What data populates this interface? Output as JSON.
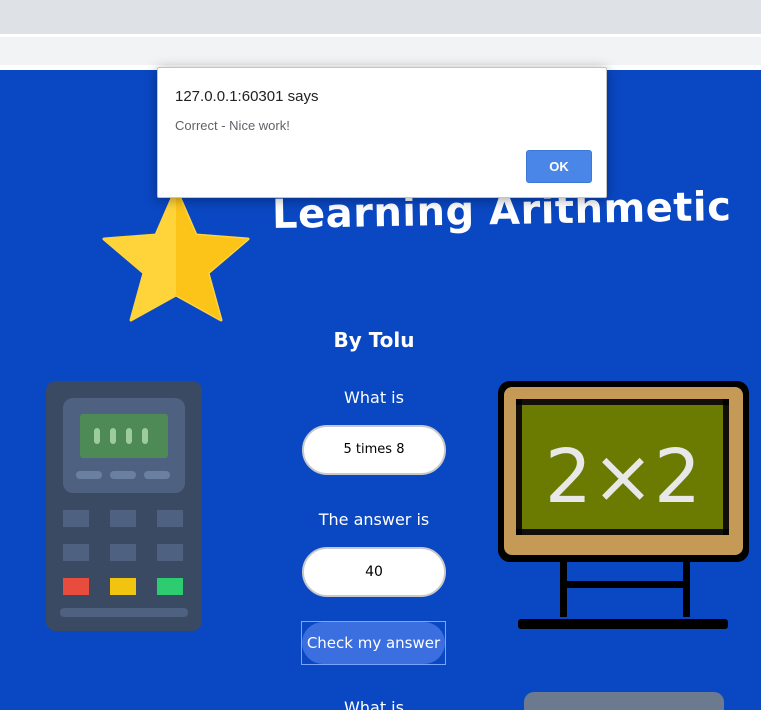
{
  "dialog": {
    "title": "127.0.0.1:60301 says",
    "message": "Correct - Nice work!",
    "ok_label": "OK"
  },
  "page": {
    "title": "Learning Arithmetic",
    "byline": "By Tolu",
    "question_label": "What is",
    "question_value": "5 times 8",
    "answer_label": "The answer is",
    "answer_value": "40",
    "check_button_label": "Check my answer",
    "next_question_label": "What is"
  },
  "board_text": "2×2",
  "colors": {
    "background": "#0a47c2",
    "star": "#ffd43b",
    "ok_button": "#4a86e8",
    "calc_red": "#e74c3c",
    "calc_yellow": "#f1c40f",
    "calc_green": "#2ecc71",
    "board_green": "#6b7a00"
  },
  "icons": [
    "star-icon",
    "calculator-icon",
    "chalkboard-icon"
  ]
}
